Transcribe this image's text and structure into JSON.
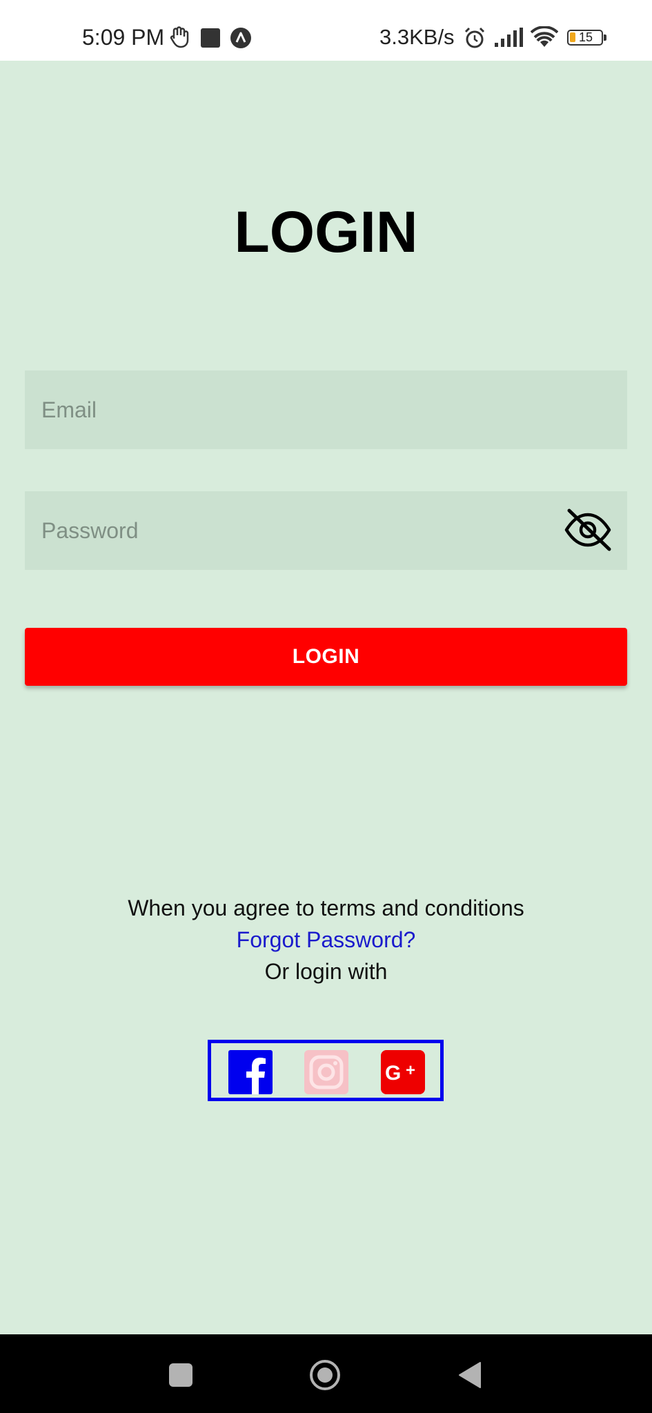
{
  "status_bar": {
    "time": "5:09 PM",
    "net_speed": "3.3KB/s",
    "battery_level": "15",
    "icons": [
      "hand-gesture-icon",
      "square-notification-icon",
      "app-a-icon",
      "alarm-icon",
      "signal-icon",
      "wifi-icon",
      "battery-icon"
    ]
  },
  "header": {
    "title": "LOGIN"
  },
  "form": {
    "email_placeholder": "Email",
    "email_value": "",
    "password_placeholder": "Password",
    "password_value": "",
    "password_toggle_icon": "eye-off-icon",
    "login_label": "LOGIN"
  },
  "footer": {
    "terms": "When you agree to terms and conditions",
    "forgot_password": "Forgot Password?",
    "or_login_with": "Or login with"
  },
  "social": {
    "items": [
      {
        "name": "facebook-icon",
        "color": "#0000ee"
      },
      {
        "name": "instagram-icon",
        "color": "#f6c1c6"
      },
      {
        "name": "google-plus-icon",
        "color": "#ee0000"
      }
    ]
  },
  "nav_bar": {
    "icons": [
      "recent-apps-icon",
      "home-icon",
      "back-icon"
    ]
  },
  "colors": {
    "background": "#d8ecdc",
    "field_bg": "#cbe1d0",
    "login_button": "#ff0000",
    "link": "#1a1acc",
    "social_border": "#0000ee"
  }
}
